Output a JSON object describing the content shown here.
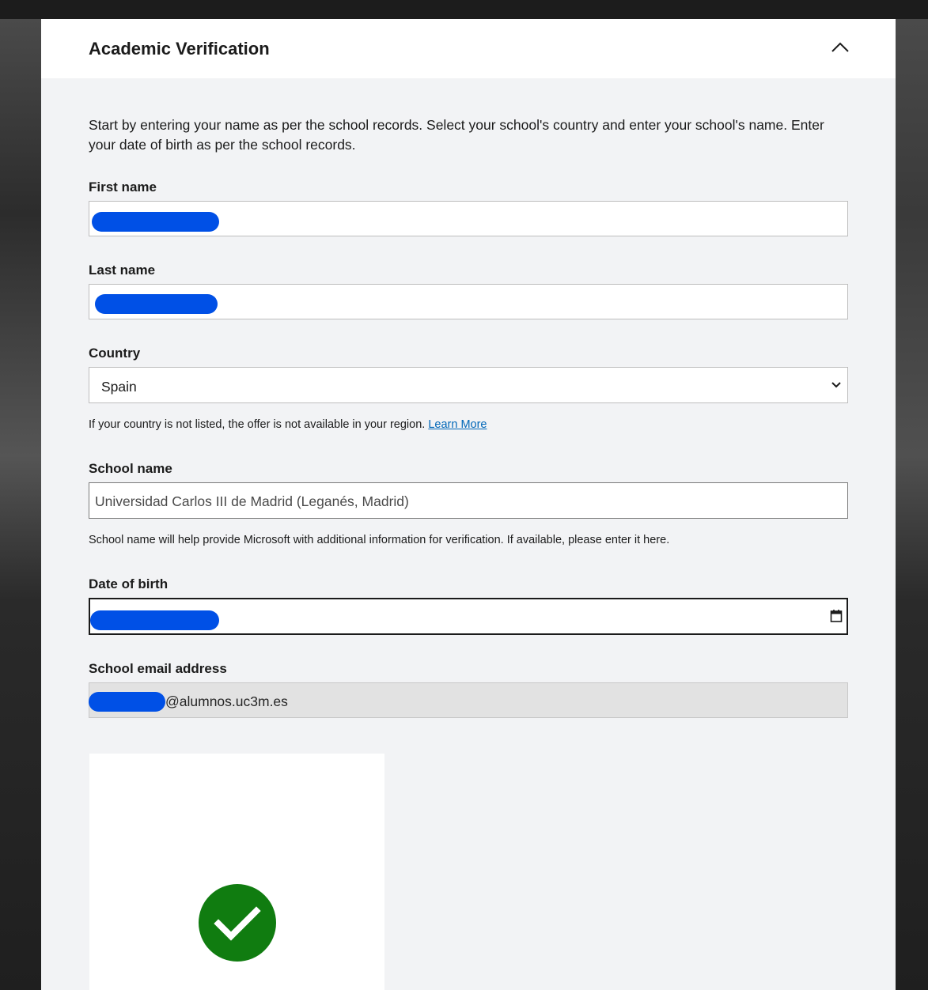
{
  "panel": {
    "title": "Academic Verification",
    "intro": "Start by entering your name as per the school records. Select your school's country and enter your school's name. Enter your date of birth as per the school records."
  },
  "first_name": {
    "label": "First name"
  },
  "last_name": {
    "label": "Last name"
  },
  "country": {
    "label": "Country",
    "selected": "Spain",
    "hint": "If your country is not listed, the offer is not available in your region.",
    "learn_more": "Learn More"
  },
  "school_name": {
    "label": "School name",
    "value": "Universidad Carlos III de Madrid (Leganés, Madrid)",
    "hint": "School name will help provide Microsoft with additional information for verification. If available, please enter it here."
  },
  "date_of_birth": {
    "label": "Date of birth"
  },
  "school_email": {
    "label": "School email address",
    "domain": "@alumnos.uc3m.es"
  },
  "colors": {
    "accent_link": "#0067b8",
    "success": "#107c10",
    "redaction": "#0050e6"
  }
}
